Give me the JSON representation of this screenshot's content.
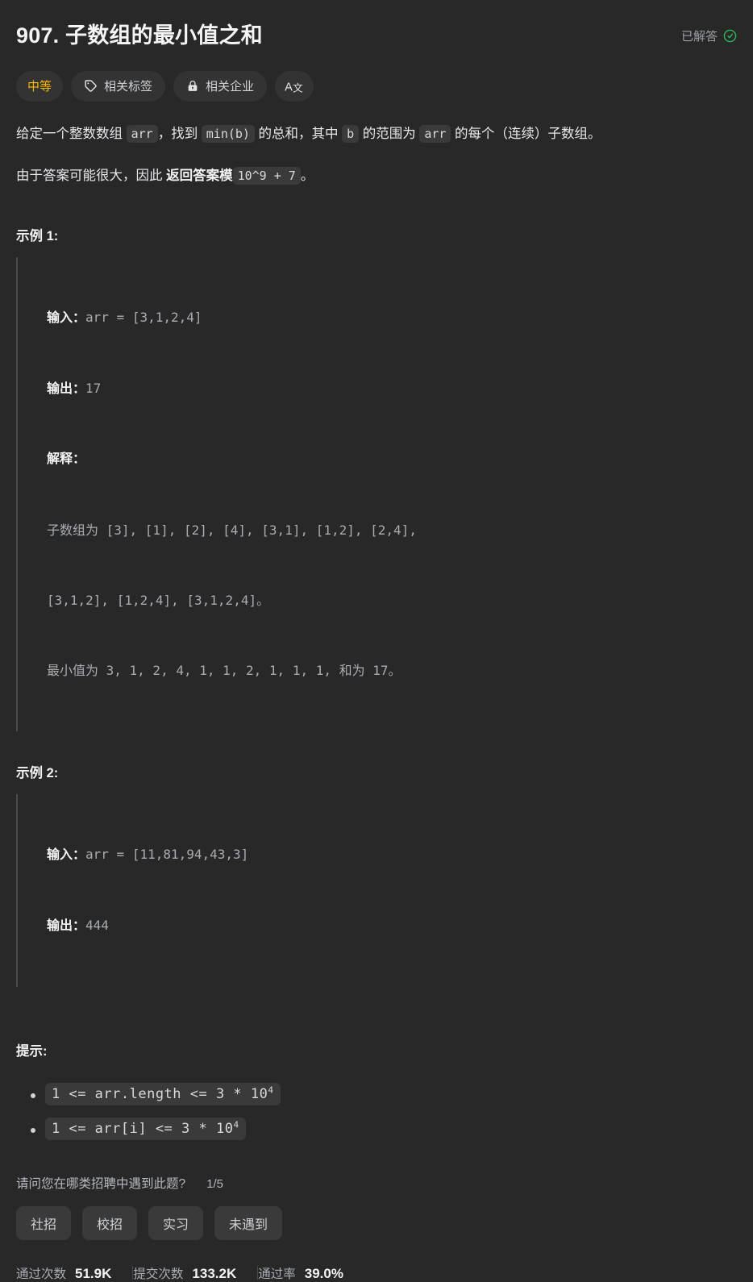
{
  "header": {
    "title": "907. 子数组的最小值之和",
    "solved_label": "已解答",
    "solved_icon": "check-circle-icon",
    "solved_color": "#2db55d"
  },
  "chips": {
    "difficulty": {
      "label": "中等",
      "color": "#ffb800"
    },
    "tags": {
      "label": "相关标签",
      "icon": "tag-icon"
    },
    "companies": {
      "label": "相关企业",
      "icon": "lock-icon"
    },
    "translate": {
      "icon": "translate-icon",
      "label": "A文"
    }
  },
  "description": {
    "p1_a": "给定一个整数数组 ",
    "p1_code1": "arr",
    "p1_b": "，找到 ",
    "p1_code2": "min(b)",
    "p1_c": " 的总和，其中 ",
    "p1_code3": "b",
    "p1_d": " 的范围为 ",
    "p1_code4": "arr",
    "p1_e": " 的每个（连续）子数组。",
    "p2_a": "由于答案可能很大，因此 ",
    "p2_bold": "返回答案模",
    "p2_code": "10^9 + 7",
    "p2_b": "。"
  },
  "examples": [
    {
      "heading": "示例 1:",
      "input_label": "输入：",
      "input_value": "arr = [3,1,2,4]",
      "output_label": "输出：",
      "output_value": "17",
      "explain_label": "解释：",
      "explain_lines": [
        "子数组为 [3], [1], [2], [4], [3,1], [1,2], [2,4],",
        "[3,1,2], [1,2,4], [3,1,2,4]。",
        "最小值为 3, 1, 2, 4, 1, 1, 2, 1, 1, 1, 和为 17。"
      ]
    },
    {
      "heading": "示例 2:",
      "input_label": "输入：",
      "input_value": "arr = [11,81,94,43,3]",
      "output_label": "输出：",
      "output_value": "444",
      "explain_label": "",
      "explain_lines": []
    }
  ],
  "hints": {
    "heading": "提示:",
    "items": [
      {
        "text": "1 <= arr.length <= 3 * 10",
        "sup": "4"
      },
      {
        "text": "1 <= arr[i] <= 3 * 10",
        "sup": "4"
      }
    ]
  },
  "survey": {
    "question": "请问您在哪类招聘中遇到此题?",
    "counter": "1/5",
    "options": [
      "社招",
      "校招",
      "实习",
      "未遇到"
    ]
  },
  "stats": [
    {
      "label": "通过次数",
      "value": "51.9K"
    },
    {
      "label": "提交次数",
      "value": "133.2K"
    },
    {
      "label": "通过率",
      "value": "39.0%"
    }
  ]
}
